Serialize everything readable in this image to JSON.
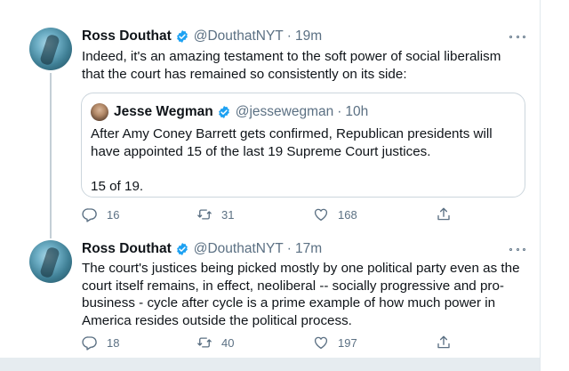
{
  "tweets": [
    {
      "name": "Ross Douthat",
      "handle": "@DouthatNYT",
      "separator": "·",
      "time": "19m",
      "text": "Indeed, it's an amazing testament to the soft power of social liberalism\nthat the court has remained so consistently on its side:",
      "quote": {
        "name": "Jesse Wegman",
        "handle": "@jessewegman",
        "separator": "·",
        "time": "10h",
        "text": "After Amy Coney Barrett gets confirmed, Republican presidents will\nhave appointed 15 of the last 19 Supreme Court justices.\n\n15 of 19."
      },
      "replies": "16",
      "retweets": "31",
      "likes": "168"
    },
    {
      "name": "Ross Douthat",
      "handle": "@DouthatNYT",
      "separator": "·",
      "time": "17m",
      "text": "The court's justices being picked mostly by one political party even as the\ncourt itself remains, in effect, neoliberal -- socially progressive and pro-\nbusiness - cycle after cycle is a prime example of how much power in\nAmerica resides outside the political process.",
      "replies": "18",
      "retweets": "40",
      "likes": "197"
    }
  ],
  "icons": {
    "verified": "verified-badge-icon",
    "more": "more-options-icon",
    "reply": "reply-icon",
    "retweet": "retweet-icon",
    "like": "heart-icon",
    "share": "share-icon"
  },
  "colors": {
    "verified_blue": "#1da1f2",
    "secondary_text": "#5b7083",
    "border": "#ccd6dd",
    "background_strip": "#e6ecf0"
  }
}
